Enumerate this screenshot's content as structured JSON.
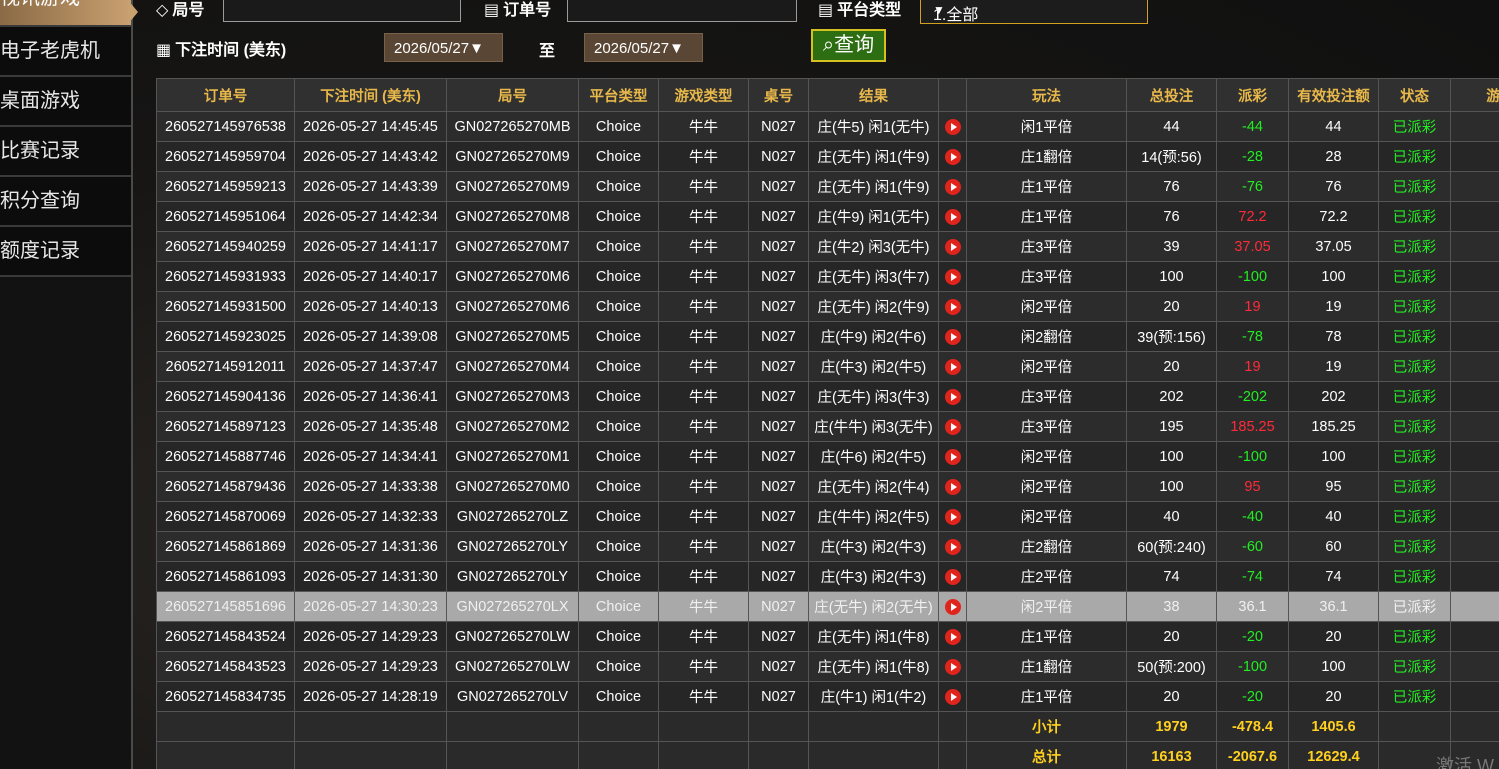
{
  "sidebar": {
    "items": [
      {
        "label": "视讯游戏"
      },
      {
        "label": "电子老虎机"
      },
      {
        "label": "桌面游戏"
      },
      {
        "label": "比赛记录"
      },
      {
        "label": "积分查询"
      },
      {
        "label": "额度记录"
      }
    ]
  },
  "filters": {
    "round_label": "局号",
    "order_label": "订单号",
    "platform_label": "平台类型",
    "platform_value": "1.全部",
    "time_label": "下注时间 (美东)",
    "date_from": "2026/05/27▼",
    "to_label": "至",
    "date_to": "2026/05/27▼",
    "query_label": "查询"
  },
  "table": {
    "headers": [
      "订单号",
      "下注时间 (美东)",
      "局号",
      "平台类型",
      "游戏类型",
      "桌号",
      "结果",
      "",
      "玩法",
      "总投注",
      "派彩",
      "有效投注额",
      "状态",
      "游"
    ],
    "rows": [
      [
        "260527145976538",
        "2026-05-27 14:45:45",
        "GN027265270MB",
        "Choice",
        "牛牛",
        "N027",
        "庄(牛5) 闲1(无牛)",
        "闲1平倍",
        "44",
        "-44",
        "44",
        "已派彩"
      ],
      [
        "260527145959704",
        "2026-05-27 14:43:42",
        "GN027265270M9",
        "Choice",
        "牛牛",
        "N027",
        "庄(无牛) 闲1(牛9)",
        "庄1翻倍",
        "14(预:56)",
        "-28",
        "28",
        "已派彩"
      ],
      [
        "260527145959213",
        "2026-05-27 14:43:39",
        "GN027265270M9",
        "Choice",
        "牛牛",
        "N027",
        "庄(无牛) 闲1(牛9)",
        "庄1平倍",
        "76",
        "-76",
        "76",
        "已派彩"
      ],
      [
        "260527145951064",
        "2026-05-27 14:42:34",
        "GN027265270M8",
        "Choice",
        "牛牛",
        "N027",
        "庄(牛9) 闲1(无牛)",
        "庄1平倍",
        "76",
        "72.2",
        "72.2",
        "已派彩"
      ],
      [
        "260527145940259",
        "2026-05-27 14:41:17",
        "GN027265270M7",
        "Choice",
        "牛牛",
        "N027",
        "庄(牛2) 闲3(无牛)",
        "庄3平倍",
        "39",
        "37.05",
        "37.05",
        "已派彩"
      ],
      [
        "260527145931933",
        "2026-05-27 14:40:17",
        "GN027265270M6",
        "Choice",
        "牛牛",
        "N027",
        "庄(无牛) 闲3(牛7)",
        "庄3平倍",
        "100",
        "-100",
        "100",
        "已派彩"
      ],
      [
        "260527145931500",
        "2026-05-27 14:40:13",
        "GN027265270M6",
        "Choice",
        "牛牛",
        "N027",
        "庄(无牛) 闲2(牛9)",
        "闲2平倍",
        "20",
        "19",
        "19",
        "已派彩"
      ],
      [
        "260527145923025",
        "2026-05-27 14:39:08",
        "GN027265270M5",
        "Choice",
        "牛牛",
        "N027",
        "庄(牛9) 闲2(牛6)",
        "闲2翻倍",
        "39(预:156)",
        "-78",
        "78",
        "已派彩"
      ],
      [
        "260527145912011",
        "2026-05-27 14:37:47",
        "GN027265270M4",
        "Choice",
        "牛牛",
        "N027",
        "庄(牛3) 闲2(牛5)",
        "闲2平倍",
        "20",
        "19",
        "19",
        "已派彩"
      ],
      [
        "260527145904136",
        "2026-05-27 14:36:41",
        "GN027265270M3",
        "Choice",
        "牛牛",
        "N027",
        "庄(无牛) 闲3(牛3)",
        "庄3平倍",
        "202",
        "-202",
        "202",
        "已派彩"
      ],
      [
        "260527145897123",
        "2026-05-27 14:35:48",
        "GN027265270M2",
        "Choice",
        "牛牛",
        "N027",
        "庄(牛牛) 闲3(无牛)",
        "庄3平倍",
        "195",
        "185.25",
        "185.25",
        "已派彩"
      ],
      [
        "260527145887746",
        "2026-05-27 14:34:41",
        "GN027265270M1",
        "Choice",
        "牛牛",
        "N027",
        "庄(牛6) 闲2(牛5)",
        "闲2平倍",
        "100",
        "-100",
        "100",
        "已派彩"
      ],
      [
        "260527145879436",
        "2026-05-27 14:33:38",
        "GN027265270M0",
        "Choice",
        "牛牛",
        "N027",
        "庄(无牛) 闲2(牛4)",
        "闲2平倍",
        "100",
        "95",
        "95",
        "已派彩"
      ],
      [
        "260527145870069",
        "2026-05-27 14:32:33",
        "GN027265270LZ",
        "Choice",
        "牛牛",
        "N027",
        "庄(牛牛) 闲2(牛5)",
        "闲2平倍",
        "40",
        "-40",
        "40",
        "已派彩"
      ],
      [
        "260527145861869",
        "2026-05-27 14:31:36",
        "GN027265270LY",
        "Choice",
        "牛牛",
        "N027",
        "庄(牛3) 闲2(牛3)",
        "庄2翻倍",
        "60(预:240)",
        "-60",
        "60",
        "已派彩"
      ],
      [
        "260527145861093",
        "2026-05-27 14:31:30",
        "GN027265270LY",
        "Choice",
        "牛牛",
        "N027",
        "庄(牛3) 闲2(牛3)",
        "庄2平倍",
        "74",
        "-74",
        "74",
        "已派彩"
      ],
      [
        "260527145851696",
        "2026-05-27 14:30:23",
        "GN027265270LX",
        "Choice",
        "牛牛",
        "N027",
        "庄(无牛) 闲2(无牛)",
        "闲2平倍",
        "38",
        "36.1",
        "36.1",
        "已派彩"
      ],
      [
        "260527145843524",
        "2026-05-27 14:29:23",
        "GN027265270LW",
        "Choice",
        "牛牛",
        "N027",
        "庄(无牛) 闲1(牛8)",
        "庄1平倍",
        "20",
        "-20",
        "20",
        "已派彩"
      ],
      [
        "260527145843523",
        "2026-05-27 14:29:23",
        "GN027265270LW",
        "Choice",
        "牛牛",
        "N027",
        "庄(无牛) 闲1(牛8)",
        "庄1翻倍",
        "50(预:200)",
        "-100",
        "100",
        "已派彩"
      ],
      [
        "260527145834735",
        "2026-05-27 14:28:19",
        "GN027265270LV",
        "Choice",
        "牛牛",
        "N027",
        "庄(牛1) 闲1(牛2)",
        "庄1平倍",
        "20",
        "-20",
        "20",
        "已派彩"
      ]
    ],
    "selected_row": 16,
    "subtotal": {
      "label": "小计",
      "total_bet": "1979",
      "payout": "-478.4",
      "valid_bet": "1405.6"
    },
    "total": {
      "label": "总计",
      "total_bet": "16163",
      "payout": "-2067.6",
      "valid_bet": "12629.4"
    }
  },
  "watermark": "激活 W",
  "colors": {
    "header_text": "#e8b84a",
    "positive_payout": "#ff2a3a",
    "negative_payout": "#22ee22",
    "status": "#22ee22",
    "sum_text": "#ffd020"
  }
}
